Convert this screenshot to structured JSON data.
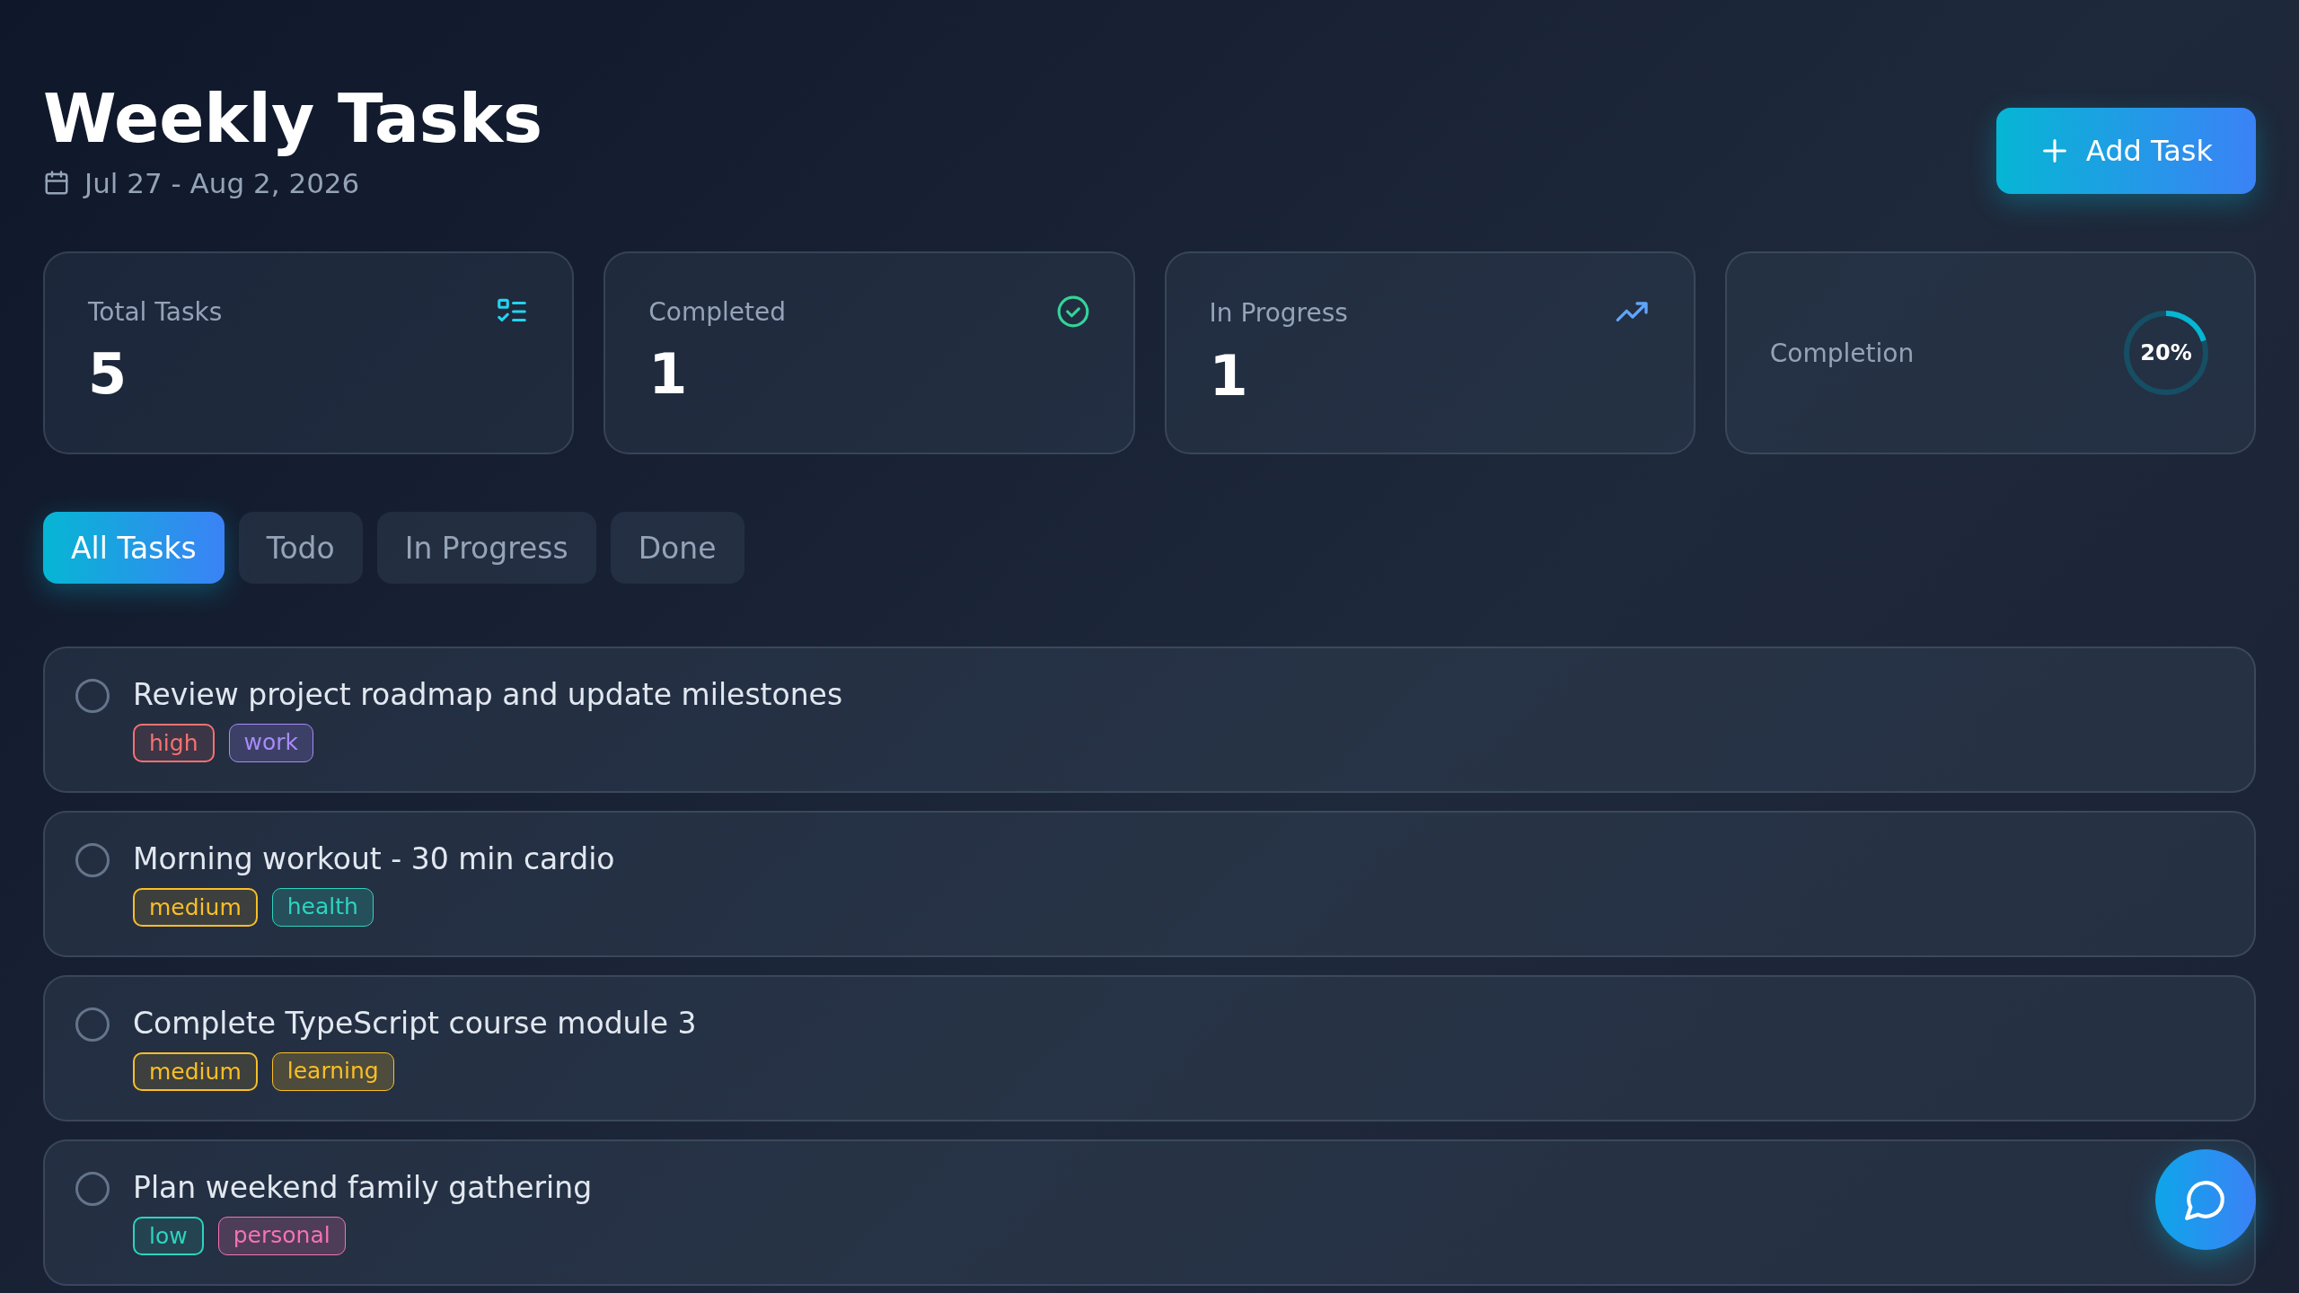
{
  "header": {
    "title": "Weekly Tasks",
    "date_range": "Jul 27 - Aug 2, 2026",
    "add_button": "Add Task"
  },
  "stats": [
    {
      "kind": "total",
      "label": "Total Tasks",
      "value": "5"
    },
    {
      "kind": "completed",
      "label": "Completed",
      "value": "1"
    },
    {
      "kind": "progress",
      "label": "In Progress",
      "value": "1"
    }
  ],
  "completion": {
    "label": "Completion",
    "value": "20%",
    "level": 0.2
  },
  "tabs": [
    {
      "label": "All Tasks",
      "selected": true
    },
    {
      "label": "Todo",
      "selected": false
    },
    {
      "label": "In Progress",
      "selected": false
    },
    {
      "label": "Done",
      "selected": false
    }
  ],
  "tasks": [
    {
      "title": "Review project roadmap and update milestones",
      "checked": false,
      "tags": [
        {
          "kind": "priority",
          "label": "high",
          "color": "#f87171"
        },
        {
          "kind": "category",
          "label": "work",
          "color": "#a78bfa"
        }
      ]
    },
    {
      "title": "Morning workout - 30 min cardio",
      "checked": false,
      "tags": [
        {
          "kind": "priority",
          "label": "medium",
          "color": "#fbbf24"
        },
        {
          "kind": "category",
          "label": "health",
          "color": "#2dd4bf"
        }
      ]
    },
    {
      "title": "Complete TypeScript course module 3",
      "checked": false,
      "tags": [
        {
          "kind": "priority",
          "label": "medium",
          "color": "#fbbf24"
        },
        {
          "kind": "category",
          "label": "learning",
          "color": "#fbbf24"
        }
      ]
    },
    {
      "title": "Plan weekend family gathering",
      "checked": false,
      "tags": [
        {
          "kind": "priority",
          "label": "low",
          "color": "#2dd4bf"
        },
        {
          "kind": "category",
          "label": "personal",
          "color": "#f472b6"
        }
      ]
    }
  ]
}
